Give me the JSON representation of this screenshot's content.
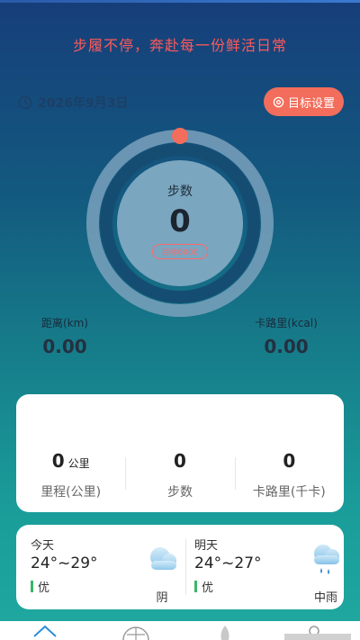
{
  "header": {
    "slogan": "步履不停，奔赴每一份鲜活日常",
    "date": "2026年9月3日",
    "goal_button": "目标设置"
  },
  "steps": {
    "label": "步数",
    "value": "0",
    "target": "目标6000"
  },
  "distance": {
    "label": "距离(km)",
    "value": "0.00"
  },
  "calories": {
    "label": "卡路里(kcal)",
    "value": "0.00"
  },
  "summary": {
    "mileage": {
      "value": "0",
      "unit": "公里",
      "label": "里程(公里)"
    },
    "steps": {
      "value": "0",
      "label": "步数"
    },
    "calories": {
      "value": "0",
      "label": "卡路里(千卡)"
    }
  },
  "weather": {
    "today": {
      "day": "今天",
      "temp": "24°~29°",
      "aqi": "优",
      "condition": "阴",
      "icon": "cloudy-icon"
    },
    "tomorrow": {
      "day": "明天",
      "temp": "24°~27°",
      "aqi": "优",
      "condition": "中雨",
      "icon": "rain-icon"
    }
  },
  "tabs": [
    "home-icon",
    "globe-icon",
    "flame-icon",
    "profile-icon"
  ],
  "colors": {
    "accent": "#f26d5b",
    "slogan": "#ff5a5a",
    "aqi_good": "#3cb56a",
    "progress_dot": "#f26d5b"
  }
}
